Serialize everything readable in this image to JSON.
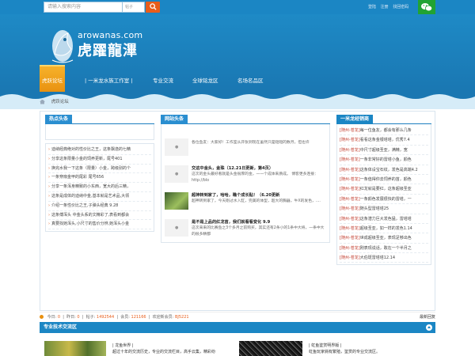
{
  "topbar": {
    "search_placeholder": "请输入搜索内容",
    "search_type": "帖子",
    "login": "登陆",
    "register": "注册",
    "forgot": "找回密码"
  },
  "brand": {
    "logo_en": "arowanas.com",
    "logo_cn": "虎躍龍滭"
  },
  "nav": [
    {
      "label": "虎跃论坛"
    },
    {
      "label": "| 一米龙水族工作室 |"
    },
    {
      "label": "专业交流"
    },
    {
      "label": "全球铭龙区"
    },
    {
      "label": "名场名品区"
    }
  ],
  "breadcrumb": {
    "current": "虎跃论坛"
  },
  "hot": {
    "title": "热点头条",
    "items": [
      "迪纳经典绝对的性价比之王，这条飘逸的七精",
      "分享这条限量小金的饲养更新，尾号401",
      "换完水我一下这条（限量）小金，跨级别的个",
      "一条穿扇金甲的尾彩 尾号656",
      "分享一条浑身精致的小东西，宽大的后三精，",
      "这条是成体的迪纳中金,基本就是艺术品,大领",
      "介绍一条性价比之王,子弹头经典 9.28",
      "这条傅浑头 中金头系的文精彩了,表看到都会",
      "真要找她浑头,小尺寸的售价分辨,她浑头小金"
    ]
  },
  "news": {
    "title": "网站头条",
    "items": [
      {
        "title": "",
        "desc": "各位鱼友：大家好！工作室从开张到现在虽然只是短短的数月，但也许"
      },
      {
        "title": "交这中金头，金珠（12.21日更新，第4页）",
        "desc": "这次的金头最好看就是头金很厚的金，一一个成体来质成。 博客更多连接：http://blo"
      },
      {
        "title": "超神转到家了，哈哈，瞧个成长贴！（6.20更新",
        "desc": "超神转到家了，今天刚过水入缸，完美的体型，超大的胸器，牛X的发色，...."
      },
      {
        "title": "是不是上品的红龙苗，我们就看看变化 9.9",
        "desc": "这次来来的比赛鱼之3个多月之前购买，其实还有2条小的1条中大将，一条中大的很多精都"
      }
    ]
  },
  "dragon": {
    "title": "一米龙经销商",
    "items": [
      {
        "city": "[随州-苍龙]",
        "text": "每一位鱼友，都会有那么几条"
      },
      {
        "city": "[随州-苍龙]",
        "text": "看看这条金银塔塔，优秀7.4"
      },
      {
        "city": "[随州-苍龙]",
        "text": "中尺寸超级圣亚，满精，宽"
      },
      {
        "city": "[随州-苍龙]",
        "text": "一条非常好的雷塔小鱼，颜色"
      },
      {
        "city": "[随州-苍龙]",
        "text": "这条体设宝石纹，发色是高端4.2"
      },
      {
        "city": "[随州-苍龙]",
        "text": "一条值得你去饲养的苗，颜色"
      },
      {
        "city": "[随州-苍龙]",
        "text": "红龙就是要红，这条超级圣亚"
      },
      {
        "city": "[随州-苍龙]",
        "text": "一条颜色发展很快的雷塔，一"
      },
      {
        "city": "[随州-苍龙]",
        "text": "随头型雷塔塔25"
      },
      {
        "city": "[随州-苍龙]",
        "text": "这条潜力巨大发色猛，雷塔塔"
      },
      {
        "city": "[随州-苍龙]",
        "text": "超级圣亚，如一样的发色1.14"
      },
      {
        "city": "[随州-苍龙]",
        "text": "世成超级圣亚，表现足够出色"
      },
      {
        "city": "[随州-苍龙]",
        "text": "刚表现说话，敢在一个半月之"
      },
      {
        "city": "[随州-苍龙]",
        "text": "大伯斑雷塔塔12.14"
      }
    ]
  },
  "stats": {
    "today_label": "今日:",
    "today": "0",
    "yesterday_label": "昨日:",
    "yesterday": "0",
    "posts_label": "帖子:",
    "posts": "1492544",
    "members_label": "会员:",
    "members": "121166",
    "newest_member_label": "欢迎新会员:",
    "newest_member": "BJ5221",
    "newest_reply": "最新回复"
  },
  "section": {
    "title": "专业技术交流区",
    "card1_title": "| 龙鱼世界 |",
    "card1_desc": "超过十年的交流历史，专业的交流栏目，高手云集，精彩纷",
    "card2_title": "| 虹鱼鉴赏明界版 |",
    "card2_desc": "虹鱼玩家倘有繁殖，鉴赏的专业交流区。"
  }
}
